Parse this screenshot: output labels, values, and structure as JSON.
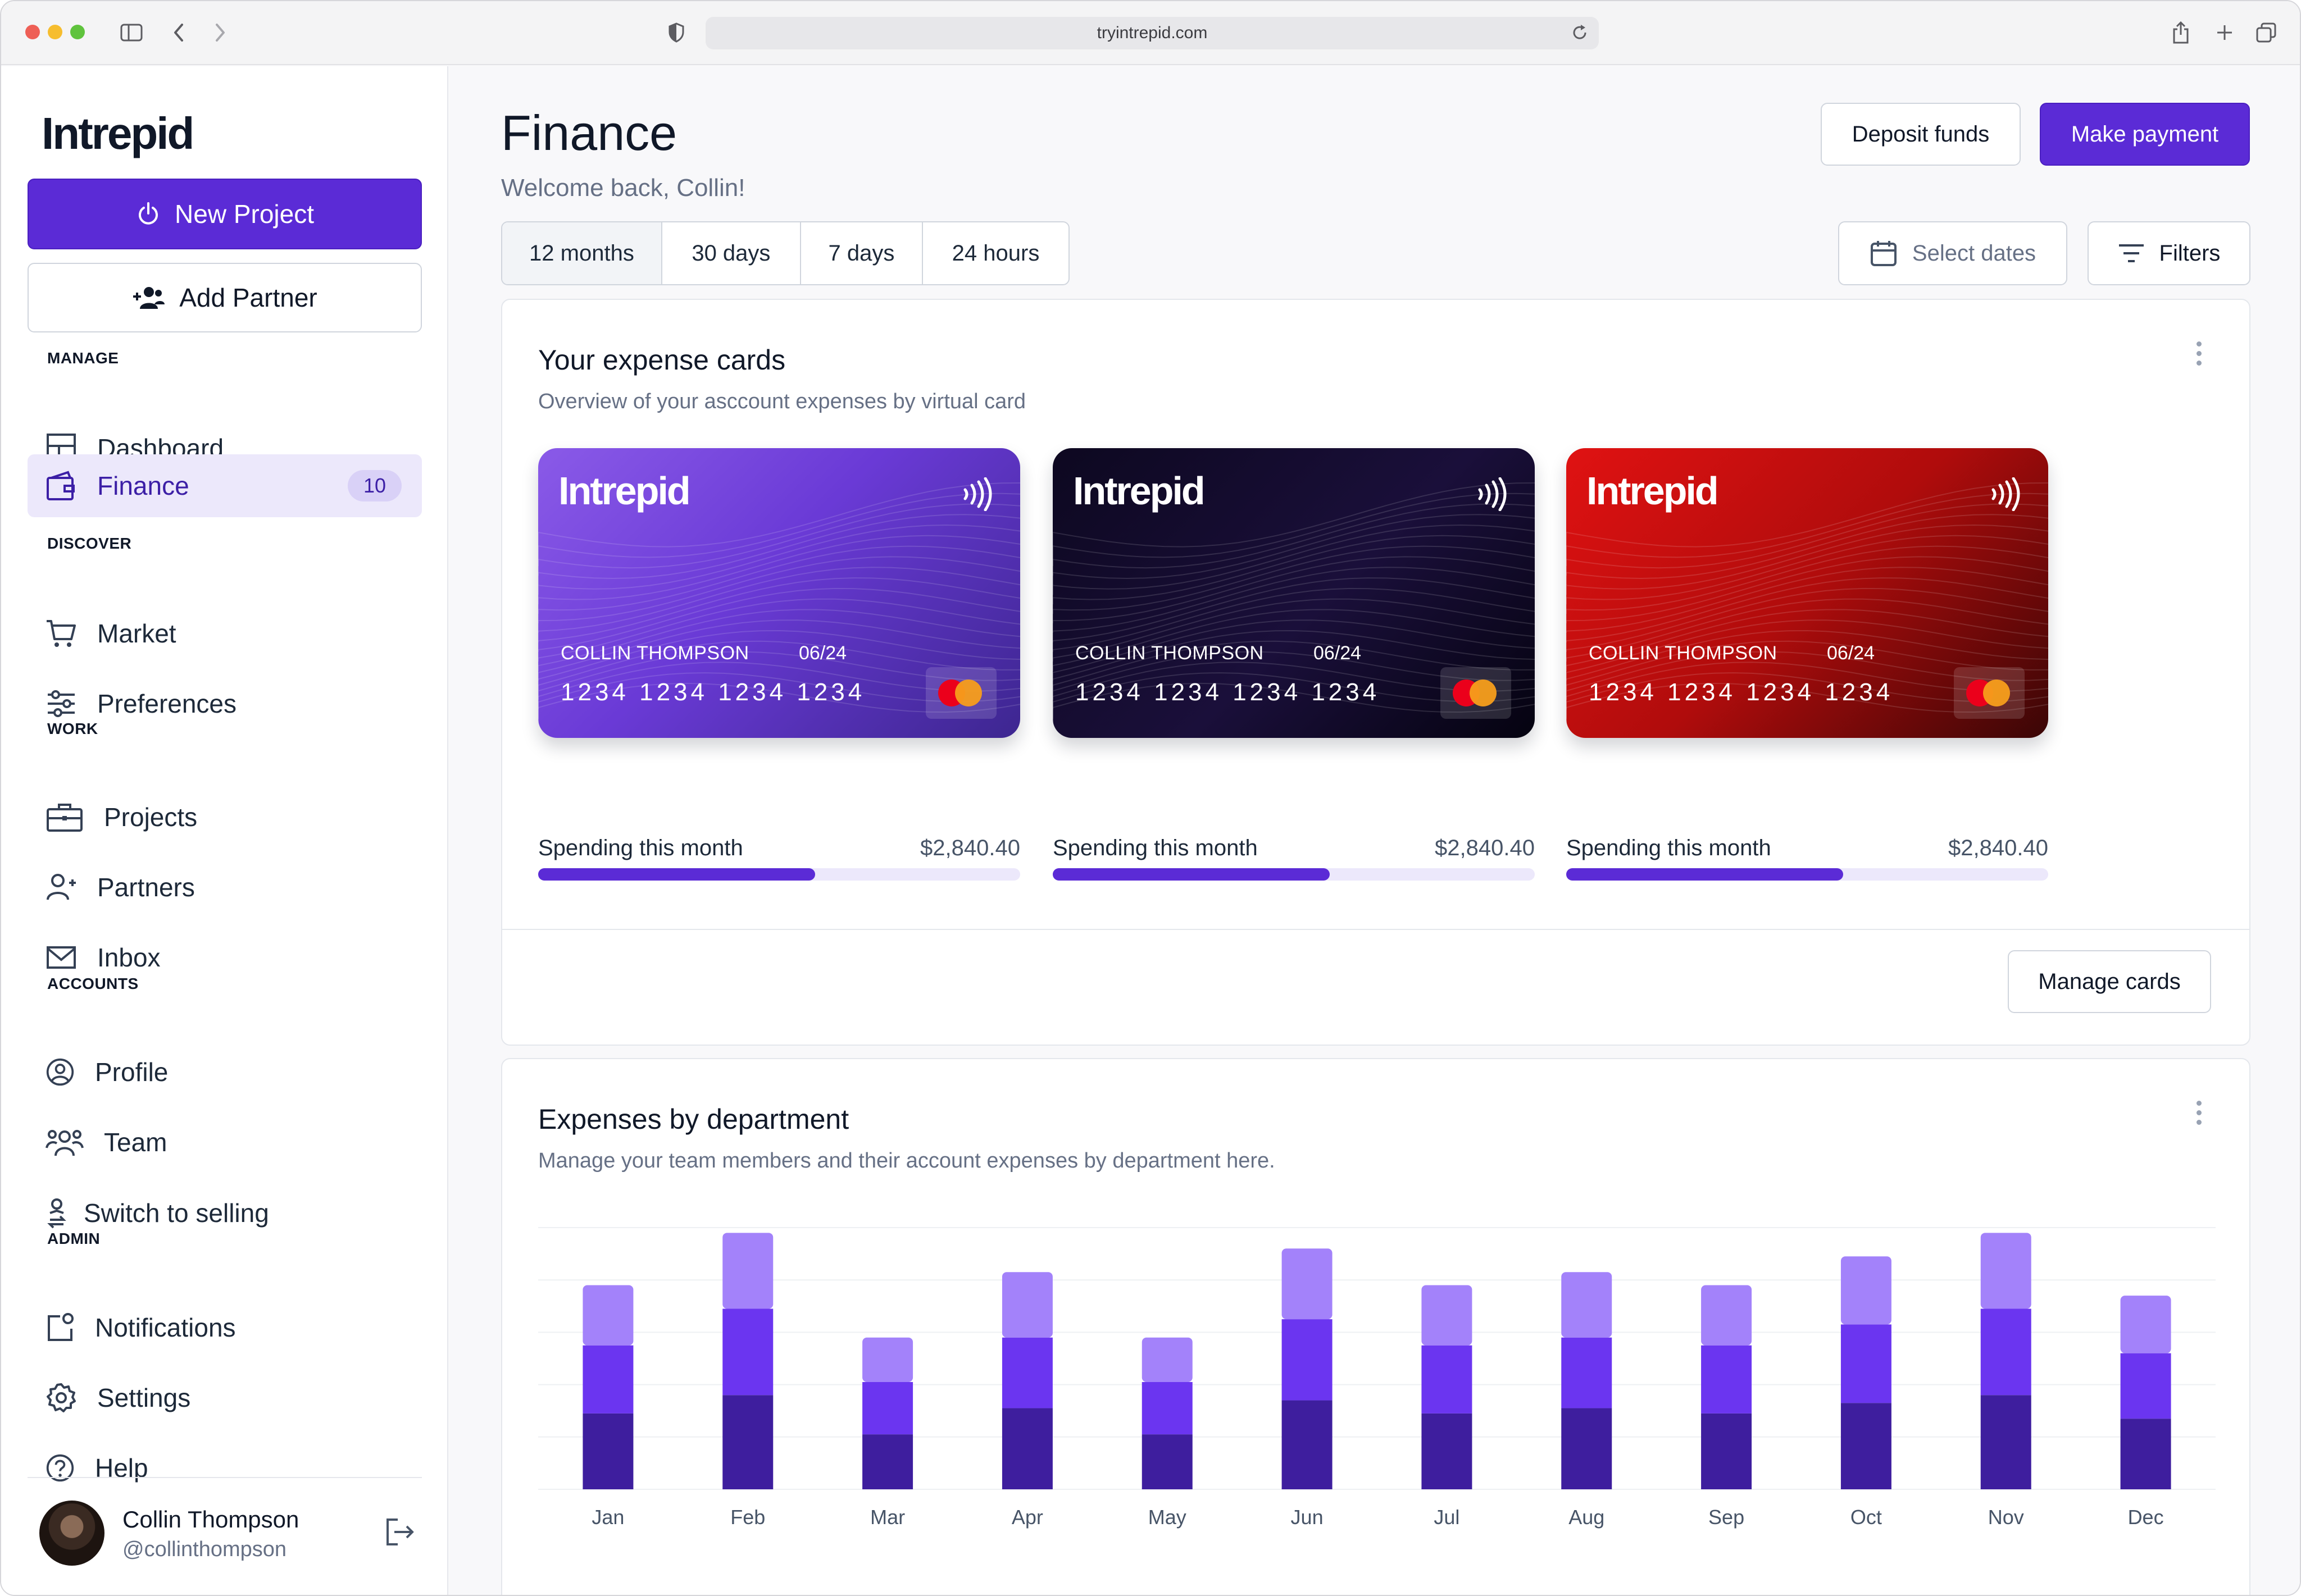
{
  "browser": {
    "url": "tryintrepid.com"
  },
  "sidebar": {
    "logo": "Intrepid",
    "new_project": "New Project",
    "add_partner": "Add Partner",
    "sections": {
      "manage": "MANAGE",
      "discover": "DISCOVER",
      "work": "WORK",
      "accounts": "ACCOUNTS",
      "admin": "ADMIN"
    },
    "items": {
      "dashboard": "Dashboard",
      "finance": "Finance",
      "finance_badge": "10",
      "market": "Market",
      "preferences": "Preferences",
      "projects": "Projects",
      "partners": "Partners",
      "inbox": "Inbox",
      "profile": "Profile",
      "team": "Team",
      "switch_selling": "Switch to selling",
      "notifications": "Notifications",
      "settings": "Settings",
      "help": "Help"
    },
    "user": {
      "name": "Collin Thompson",
      "handle": "@collinthompson"
    }
  },
  "header": {
    "title": "Finance",
    "subtitle": "Welcome back, Collin!",
    "deposit": "Deposit funds",
    "payment": "Make payment",
    "ranges": [
      "12 months",
      "30 days",
      "7 days",
      "24 hours"
    ],
    "selected_range": "12 months",
    "select_dates": "Select dates",
    "filters": "Filters"
  },
  "expense_cards": {
    "title": "Your expense cards",
    "subtitle": "Overview of your asccount expenses by virtual card",
    "manage": "Manage cards",
    "cards": [
      {
        "brand": "Intrepid",
        "holder": "COLLIN THOMPSON",
        "expiry": "06/24",
        "number": "1234 1234 1234 1234",
        "theme": "#6a3ad6",
        "spend_label": "Spending this month",
        "spend_amount": "$2,840.40",
        "spend_fraction": 0.575
      },
      {
        "brand": "Intrepid",
        "holder": "COLLIN THOMPSON",
        "expiry": "06/24",
        "number": "1234 1234 1234 1234",
        "theme": "#0d0820",
        "spend_label": "Spending this month",
        "spend_amount": "$2,840.40",
        "spend_fraction": 0.575
      },
      {
        "brand": "Intrepid",
        "holder": "COLLIN THOMPSON",
        "expiry": "06/24",
        "number": "1234 1234 1234 1234",
        "theme": "#c00f0f",
        "spend_label": "Spending this month",
        "spend_amount": "$2,840.40",
        "spend_fraction": 0.575
      }
    ]
  },
  "department": {
    "title": "Expenses by department",
    "subtitle": "Manage your team members and their account expenses by department here."
  },
  "chart_data": {
    "type": "bar",
    "stacked": true,
    "categories": [
      "Jan",
      "Feb",
      "Mar",
      "Apr",
      "May",
      "Jun",
      "Jul",
      "Aug",
      "Sep",
      "Oct",
      "Nov",
      "Dec"
    ],
    "series": [
      {
        "values": [
          29,
          36,
          21,
          31,
          21,
          34,
          29,
          31,
          29,
          33,
          36,
          27
        ],
        "color": "#3e1e9e"
      },
      {
        "values": [
          26,
          33,
          20,
          27,
          20,
          31,
          26,
          27,
          26,
          30,
          33,
          25
        ],
        "color": "#6b35f0"
      },
      {
        "values": [
          23,
          29,
          17,
          25,
          17,
          27,
          23,
          25,
          23,
          26,
          29,
          22
        ],
        "color": "#a382fa"
      }
    ],
    "ylim": [
      0,
      100
    ],
    "grid": true,
    "colors": {
      "bottom": "#3e1e9e",
      "middle": "#6b35f0",
      "top": "#a382fa"
    }
  },
  "colors": {
    "accent": "#5b2bd6",
    "active_bg": "#ece8fb"
  }
}
